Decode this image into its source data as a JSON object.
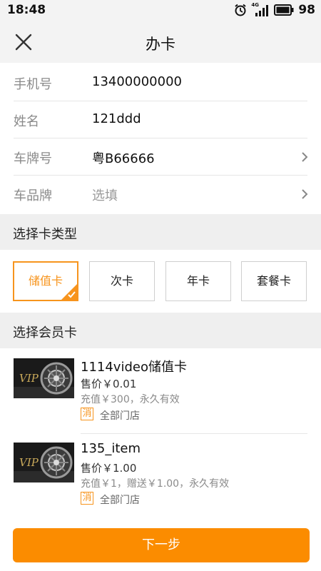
{
  "status": {
    "time": "18:48",
    "network": "4G",
    "battery": "98"
  },
  "nav": {
    "title": "办卡"
  },
  "form": {
    "phone": {
      "label": "手机号",
      "value": "13400000000"
    },
    "name": {
      "label": "姓名",
      "value": "121ddd"
    },
    "plate": {
      "label": "车牌号",
      "value": "粤B66666"
    },
    "brand": {
      "label": "车品牌",
      "placeholder": "选填"
    }
  },
  "card_type_section": {
    "title": "选择卡类型",
    "types": [
      "储值卡",
      "次卡",
      "年卡",
      "套餐卡"
    ],
    "selected": "储值卡"
  },
  "member_section": {
    "title": "选择会员卡",
    "cards": [
      {
        "name": "1114video储值卡",
        "price": "售价￥0.01",
        "desc": "充值￥300，永久有效",
        "badge": "消",
        "store": "全部门店",
        "image_text": "VIP"
      },
      {
        "name": "135_item",
        "price": "售价￥1.00",
        "desc": "充值￥1，赠送￥1.00，永久有效",
        "badge": "消",
        "store": "全部门店",
        "image_text": "VIP"
      }
    ]
  },
  "footer": {
    "next_label": "下一步"
  },
  "colors": {
    "accent": "#f7941d",
    "button": "#fb8c00",
    "section_bg": "#efefef"
  }
}
